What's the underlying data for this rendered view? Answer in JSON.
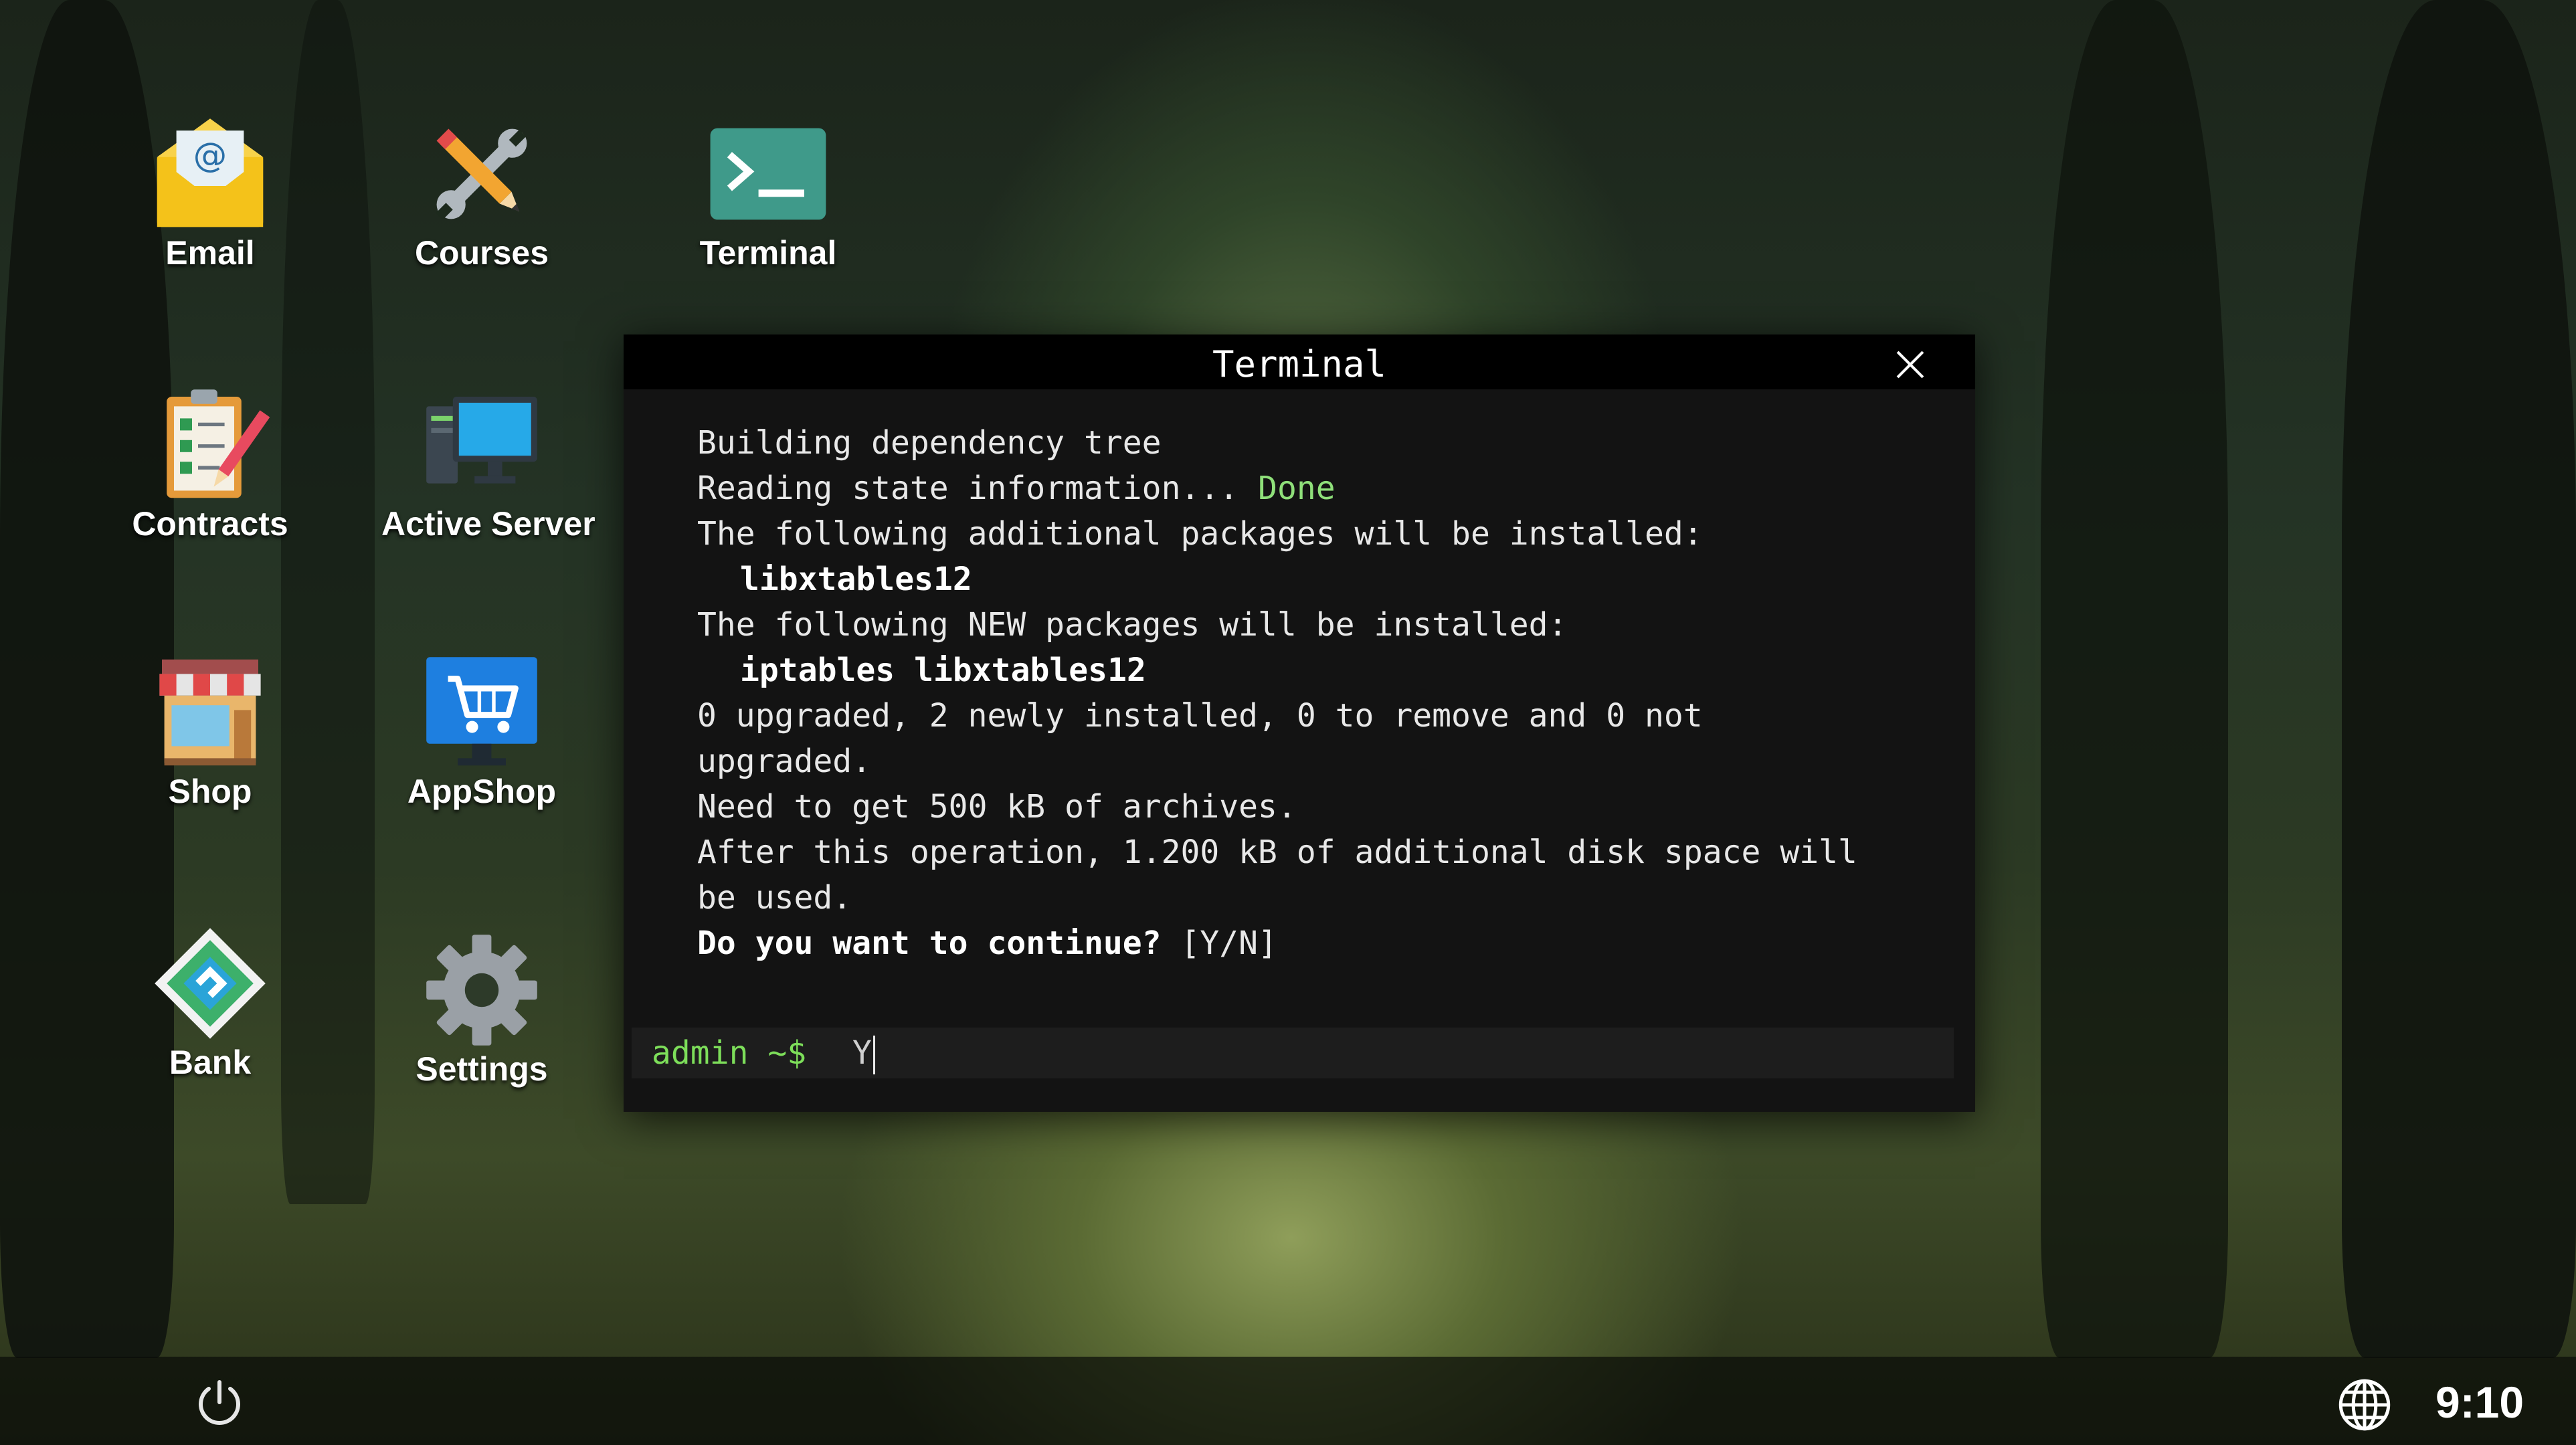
{
  "desktop": {
    "icons": [
      {
        "label": "Email",
        "icon": "email-icon"
      },
      {
        "label": "Courses",
        "icon": "courses-tools-icon"
      },
      {
        "label": "Terminal",
        "icon": "terminal-icon"
      },
      {
        "label": "Contracts",
        "icon": "contracts-clipboard-icon"
      },
      {
        "label": "Active Server",
        "icon": "server-monitor-icon"
      },
      {
        "label": "Shop",
        "icon": "shop-storefront-icon"
      },
      {
        "label": "AppShop",
        "icon": "appshop-cart-icon"
      },
      {
        "label": "Bank",
        "icon": "bank-diamond-icon"
      },
      {
        "label": "Settings",
        "icon": "gear-icon"
      }
    ]
  },
  "terminal": {
    "title": "Terminal",
    "lines": {
      "l1": "Building dependency tree",
      "l2_prefix": "Reading state information... ",
      "l2_status": "Done",
      "l3": "The following additional packages will be installed:",
      "l4": "libxtables12",
      "l5": "The following NEW packages will be installed:",
      "l6": "iptables libxtables12",
      "l7": "0 upgraded, 2 newly installed, 0 to remove and 0 not upgraded.",
      "l8": "Need to get 500 kB of archives.",
      "l9": "After this operation, 1.200 kB of additional disk space will be used.",
      "l10_question": "Do you want to continue?",
      "l10_options": " [Y/N]"
    },
    "prompt": "admin ~$",
    "input_value": "Y"
  },
  "taskbar": {
    "time": "9:10",
    "power_icon": "power-icon",
    "language_icon": "globe-icon"
  },
  "colors": {
    "terminal_bg": "#131313",
    "prompt_green": "#7dde5a",
    "done_green": "#8fe07a"
  }
}
